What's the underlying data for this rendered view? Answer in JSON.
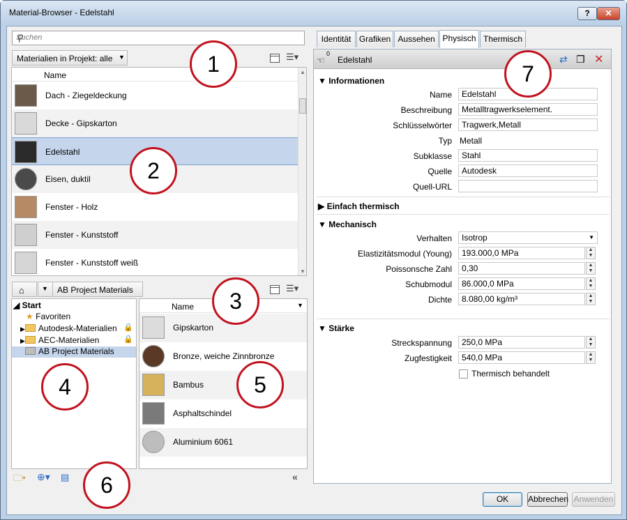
{
  "window": {
    "title": "Material-Browser - Edelstahl",
    "help": "?",
    "close": "✕"
  },
  "search": {
    "placeholder": "Suchen"
  },
  "project_filter": "Materialien in Projekt: alle",
  "list1": {
    "header": "Name",
    "items": [
      {
        "label": "Dach - Ziegeldeckung",
        "color": "#6b5a4a"
      },
      {
        "label": "Decke - Gipskarton",
        "color": "#d9d9d9"
      },
      {
        "label": "Edelstahl",
        "color": "#2a2a2a"
      },
      {
        "label": "Eisen, duktil",
        "color": "#4a4a4a"
      },
      {
        "label": "Fenster - Holz",
        "color": "#b58a64"
      },
      {
        "label": "Fenster - Kunststoff",
        "color": "#cfcfcf"
      },
      {
        "label": "Fenster - Kunststoff weiß",
        "color": "#d5d5d5"
      }
    ]
  },
  "library_crumb": "AB Project Materials",
  "tree": {
    "root": "Start",
    "items": [
      {
        "label": "Favoriten"
      },
      {
        "label": "Autodesk-Materialien"
      },
      {
        "label": "AEC-Materialien"
      },
      {
        "label": "AB Project Materials"
      }
    ]
  },
  "list2": {
    "header": "Name",
    "items": [
      {
        "label": "Gipskarton",
        "color": "#dcdcdc"
      },
      {
        "label": "Bronze, weiche Zinnbronze",
        "color": "#5a3a26"
      },
      {
        "label": "Bambus",
        "color": "#d6b35a"
      },
      {
        "label": "Asphaltschindel",
        "color": "#7a7a7a"
      },
      {
        "label": "Aluminium 6061",
        "color": "#bdbdbd"
      }
    ]
  },
  "tabs": [
    "Identität",
    "Grafiken",
    "Aussehen",
    "Physisch",
    "Thermisch"
  ],
  "asset_name": "Edelstahl",
  "asset_count": "0",
  "sections": {
    "info": "Informationen",
    "thermal": "Einfach thermisch",
    "mech": "Mechanisch",
    "strength": "Stärke"
  },
  "info": {
    "name_label": "Name",
    "name_value": "Edelstahl",
    "desc_label": "Beschreibung",
    "desc_value": "Metalltragwerkselement.",
    "kw_label": "Schlüsselwörter",
    "kw_value": "Tragwerk,Metall",
    "type_label": "Typ",
    "type_value": "Metall",
    "sub_label": "Subklasse",
    "sub_value": "Stahl",
    "src_label": "Quelle",
    "src_value": "Autodesk",
    "url_label": "Quell-URL",
    "url_value": ""
  },
  "mech": {
    "behavior_label": "Verhalten",
    "behavior_value": "Isotrop",
    "young_label": "Elastizitätsmodul (Young)",
    "young_value": "193.000,0 MPa",
    "poisson_label": "Poissonsche Zahl",
    "poisson_value": "0,30",
    "shear_label": "Schubmodul",
    "shear_value": "86.000,0 MPa",
    "density_label": "Dichte",
    "density_value": "8.080,00 kg/m³"
  },
  "strength": {
    "yield_label": "Streckspannung",
    "yield_value": "250,0 MPa",
    "tensile_label": "Zugfestigkeit",
    "tensile_value": "540,0 MPa",
    "treated_label": "Thermisch behandelt"
  },
  "buttons": {
    "ok": "OK",
    "cancel": "Abbrechen",
    "apply": "Anwenden"
  },
  "callouts": [
    "1",
    "2",
    "3",
    "4",
    "5",
    "6",
    "7"
  ]
}
